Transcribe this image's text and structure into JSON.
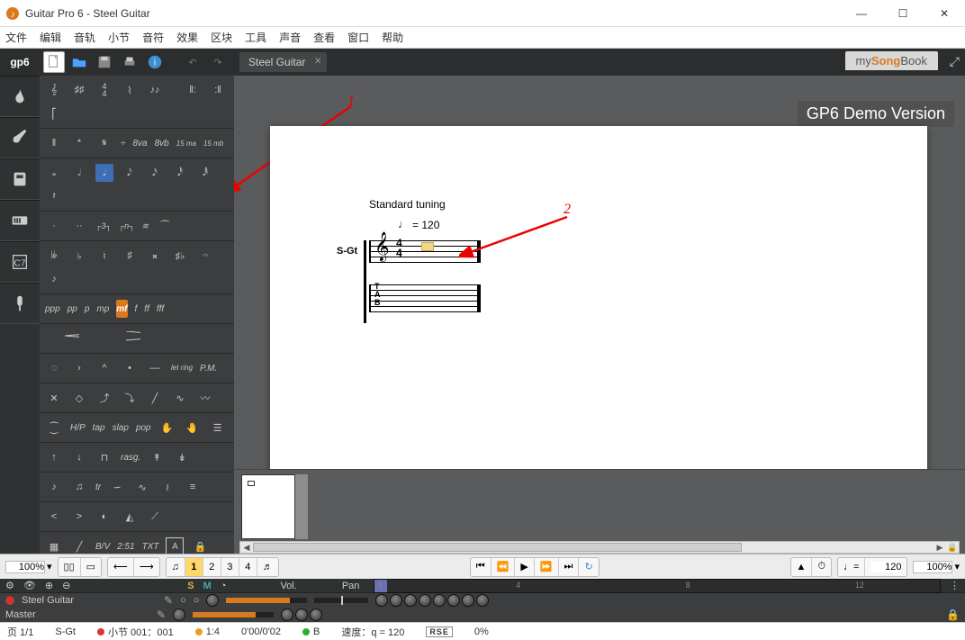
{
  "app": {
    "title": "Guitar Pro 6 - Steel Guitar"
  },
  "menu": [
    "文件",
    "编辑",
    "音轨",
    "小节",
    "音符",
    "效果",
    "区块",
    "工具",
    "声音",
    "查看",
    "窗口",
    "帮助"
  ],
  "logo": "gp6",
  "tab": {
    "title": "Steel Guitar"
  },
  "mysongbook": {
    "pre": "my",
    "mid": "Song",
    "post": "Book"
  },
  "watermark": "GP6 Demo Version",
  "score": {
    "tuning": "Standard tuning",
    "tempo_prefix": "= 120",
    "instrument_label": "S-Gt",
    "timesig_top": "4",
    "timesig_bot": "4",
    "tab_letters": [
      "T",
      "A",
      "B"
    ]
  },
  "annotations": {
    "one": "1",
    "two": "2"
  },
  "palette": {
    "row2_txt": [
      "÷",
      "8va",
      "8vb"
    ],
    "row2_frac": [
      "15 ma",
      "15 mb"
    ],
    "dyn": [
      "ppp",
      "pp",
      "p",
      "mp",
      "mf",
      "f",
      "ff",
      "fff"
    ],
    "tech": [
      "H/P",
      "tap",
      "slap",
      "pop"
    ],
    "txt_row": [
      "B/V",
      "2:51",
      "TXT"
    ],
    "let_ring": "let ring",
    "pm": "P.M.",
    "rasg": "rasg."
  },
  "transport": {
    "zoom_left": "100%",
    "tracks": [
      "1",
      "2",
      "3",
      "4"
    ],
    "tempo_box": "120",
    "zoom_right": "100%"
  },
  "mixer": {
    "headers": {
      "s": "S",
      "m": "M",
      "vol": "Vol.",
      "pan": "Pan"
    },
    "timeline_ticks": [
      "1",
      "4",
      "8",
      "12"
    ],
    "track1": "Steel Guitar",
    "track2": "Master",
    "vol_fill_pct": 78
  },
  "status": {
    "page": "页 1/1",
    "inst": "S-Gt",
    "bar": "小节 001：001",
    "beat": "1:4",
    "time": "0'00/0'02",
    "key": "B",
    "tempo": "速度：q = 120",
    "rse": "RSE",
    "pct": "0%"
  }
}
